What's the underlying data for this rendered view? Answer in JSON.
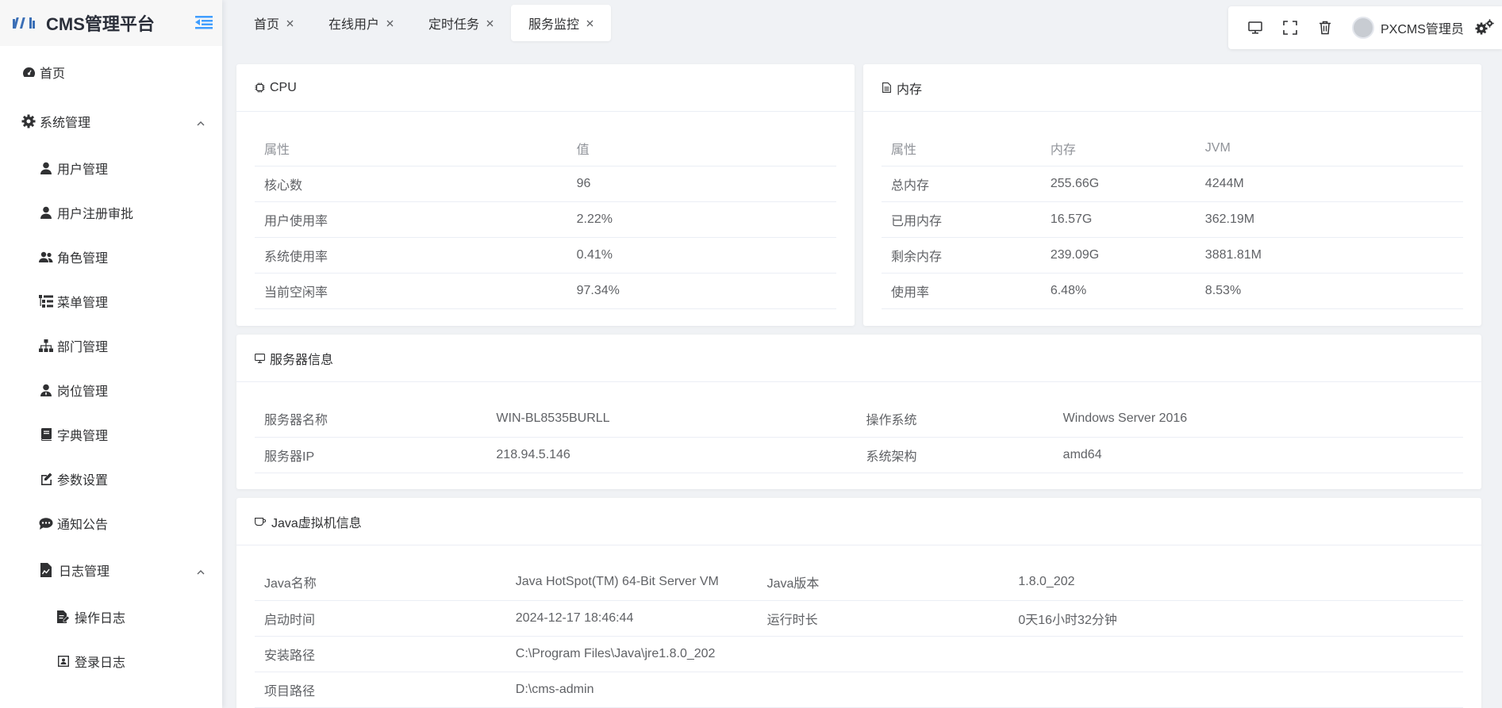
{
  "app": {
    "title": "CMS管理平台"
  },
  "sidebar": {
    "items": [
      {
        "label": "首页"
      },
      {
        "label": "系统管理"
      },
      {
        "label": "用户管理"
      },
      {
        "label": "用户注册审批"
      },
      {
        "label": "角色管理"
      },
      {
        "label": "菜单管理"
      },
      {
        "label": "部门管理"
      },
      {
        "label": "岗位管理"
      },
      {
        "label": "字典管理"
      },
      {
        "label": "参数设置"
      },
      {
        "label": "通知公告"
      },
      {
        "label": "日志管理"
      },
      {
        "label": "操作日志"
      },
      {
        "label": "登录日志"
      }
    ]
  },
  "tabs": [
    {
      "label": "首页"
    },
    {
      "label": "在线用户"
    },
    {
      "label": "定时任务"
    },
    {
      "label": "服务监控"
    }
  ],
  "header": {
    "username": "PXCMS管理员"
  },
  "cpu": {
    "title": "CPU",
    "headers": [
      "属性",
      "值"
    ],
    "rows": [
      [
        "核心数",
        "96"
      ],
      [
        "用户使用率",
        "2.22%"
      ],
      [
        "系统使用率",
        "0.41%"
      ],
      [
        "当前空闲率",
        "97.34%"
      ]
    ]
  },
  "memory": {
    "title": "内存",
    "headers": [
      "属性",
      "内存",
      "JVM"
    ],
    "rows": [
      [
        "总内存",
        "255.66G",
        "4244M"
      ],
      [
        "已用内存",
        "16.57G",
        "362.19M"
      ],
      [
        "剩余内存",
        "239.09G",
        "3881.81M"
      ],
      [
        "使用率",
        "6.48%",
        "8.53%"
      ]
    ]
  },
  "server": {
    "title": "服务器信息",
    "rows": [
      [
        "服务器名称",
        "WIN-BL8535BURLL",
        "操作系统",
        "Windows Server 2016"
      ],
      [
        "服务器IP",
        "218.94.5.146",
        "系统架构",
        "amd64"
      ]
    ]
  },
  "jvm": {
    "title": "Java虚拟机信息",
    "rows": [
      [
        "Java名称",
        "Java HotSpot(TM) 64-Bit Server VM",
        "Java版本",
        "1.8.0_202"
      ],
      [
        "启动时间",
        "2024-12-17 18:46:44",
        "运行时长",
        "0天16小时32分钟"
      ],
      [
        "安装路径",
        "C:\\Program Files\\Java\\jre1.8.0_202",
        "",
        ""
      ],
      [
        "项目路径",
        "D:\\cms-admin",
        "",
        ""
      ]
    ]
  },
  "colors": {
    "accent": "#409eff",
    "text": "#303133",
    "muted": "#909399"
  }
}
